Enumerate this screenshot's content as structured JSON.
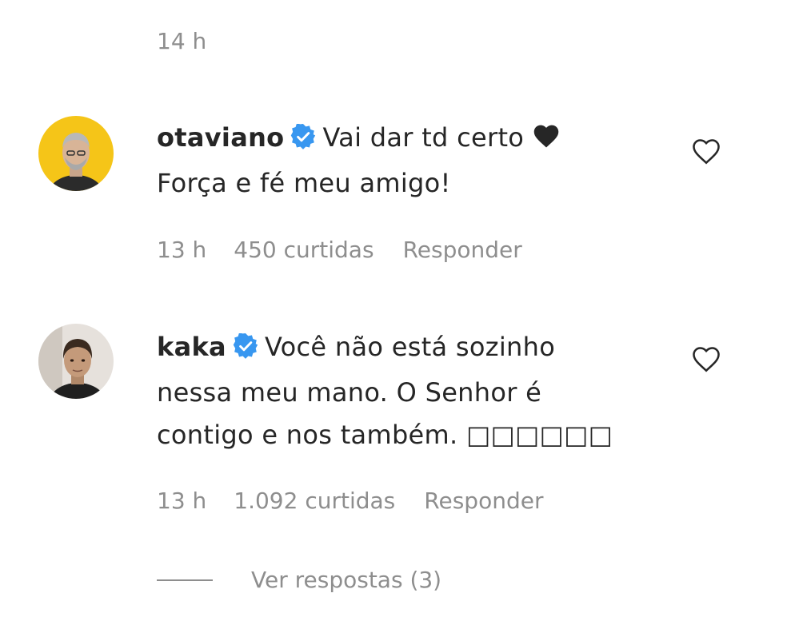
{
  "top_timestamp": "14 h",
  "colors": {
    "text": "#262626",
    "secondary": "#8e8e8e",
    "verified": "#3897f0",
    "avatar1_bg": "#f5c518"
  },
  "comments": [
    {
      "username": "otaviano",
      "verified": true,
      "text_line1": "Vai dar td certo",
      "text_emoji": "black-heart-icon",
      "text_line2": "Força e fé meu amigo!",
      "time": "13 h",
      "likes": "450 curtidas",
      "reply": "Responder",
      "like_icon": "heart-outline-icon"
    },
    {
      "username": "kaka",
      "verified": true,
      "text_line1": "Você não está sozinho",
      "text_line2": "nessa meu mano. O Senhor é",
      "text_line3": "contigo e nos também. □□□□□□",
      "time": "13 h",
      "likes": "1.092 curtidas",
      "reply": "Responder",
      "like_icon": "heart-outline-icon"
    }
  ],
  "view_replies": "Ver respostas (3)"
}
